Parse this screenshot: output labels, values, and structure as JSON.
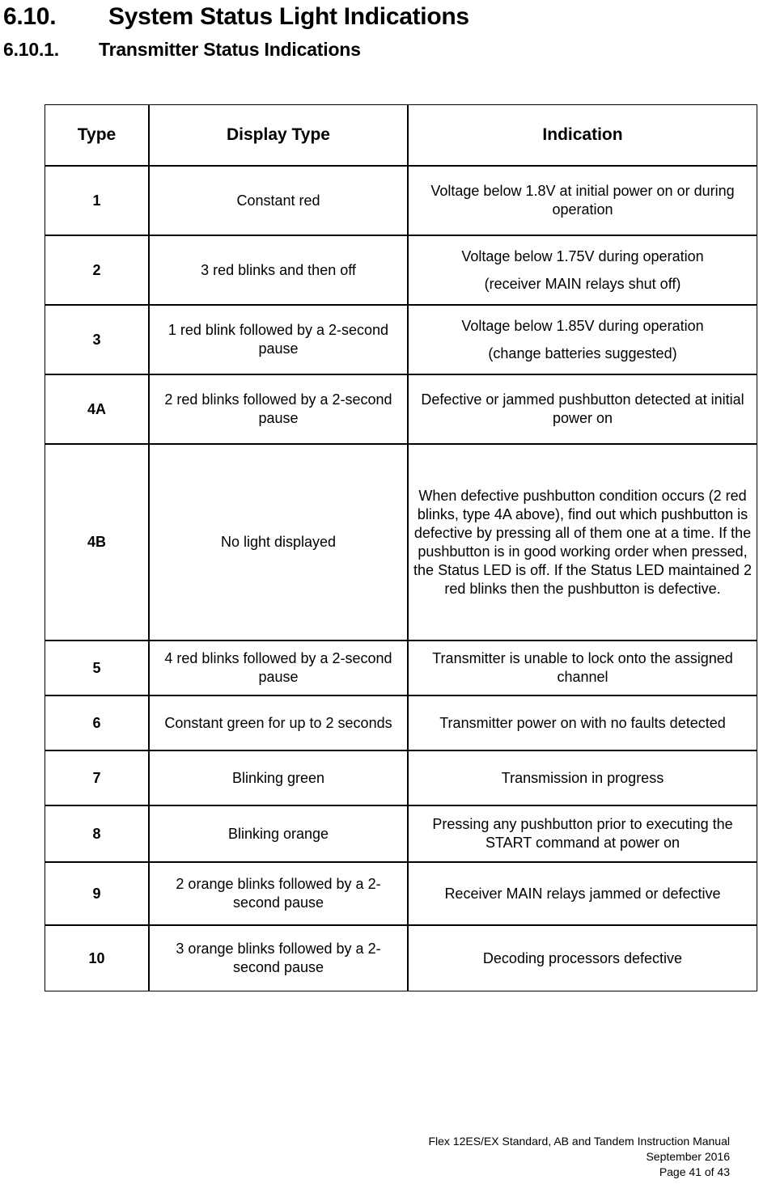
{
  "headings": {
    "section_number": "6.10.",
    "section_title": "System Status Light Indications",
    "subsection_number": "6.10.1.",
    "subsection_title": "Transmitter Status Indications"
  },
  "table": {
    "columns": [
      "Type",
      "Display Type",
      "Indication"
    ],
    "rows": [
      {
        "type": "1",
        "display": "Constant red",
        "indication": "Voltage below 1.8V at initial power on or during operation"
      },
      {
        "type": "2",
        "display": "3 red blinks and then off",
        "indication_line1": "Voltage below 1.75V during operation",
        "indication_line2": "(receiver MAIN relays shut off)"
      },
      {
        "type": "3",
        "display": "1 red blink followed by a 2-second pause",
        "indication_line1": "Voltage below 1.85V during operation",
        "indication_line2": "(change batteries suggested)"
      },
      {
        "type": "4A",
        "display": "2 red blinks followed by a 2-second pause",
        "indication": "Defective or jammed pushbutton detected at initial power on"
      },
      {
        "type": "4B",
        "display": "No light displayed",
        "indication": "When defective pushbutton condition occurs (2 red blinks, type 4A above), find out which pushbutton is defective by pressing all of them one at a time.  If the pushbutton is in good working order when pressed, the Status LED is off.  If the Status LED maintained 2 red blinks then the pushbutton is defective."
      },
      {
        "type": "5",
        "display": "4 red blinks followed by a 2-second pause",
        "indication": "Transmitter is unable to lock onto the assigned channel"
      },
      {
        "type": "6",
        "display": "Constant green for up to 2 seconds",
        "indication": "Transmitter power on with no faults detected"
      },
      {
        "type": "7",
        "display": "Blinking green",
        "indication": "Transmission in progress"
      },
      {
        "type": "8",
        "display": "Blinking orange",
        "indication": "Pressing any pushbutton prior to executing the START command at power on"
      },
      {
        "type": "9",
        "display": "2 orange blinks followed by a 2-second pause",
        "indication": "Receiver MAIN relays jammed or defective"
      },
      {
        "type": "10",
        "display": "3 orange blinks followed by a 2-second pause",
        "indication": "Decoding processors defective"
      }
    ]
  },
  "footer": {
    "line1": "Flex 12ES/EX Standard, AB and Tandem Instruction Manual",
    "line2": "September 2016",
    "line3": "Page 41 of 43"
  }
}
